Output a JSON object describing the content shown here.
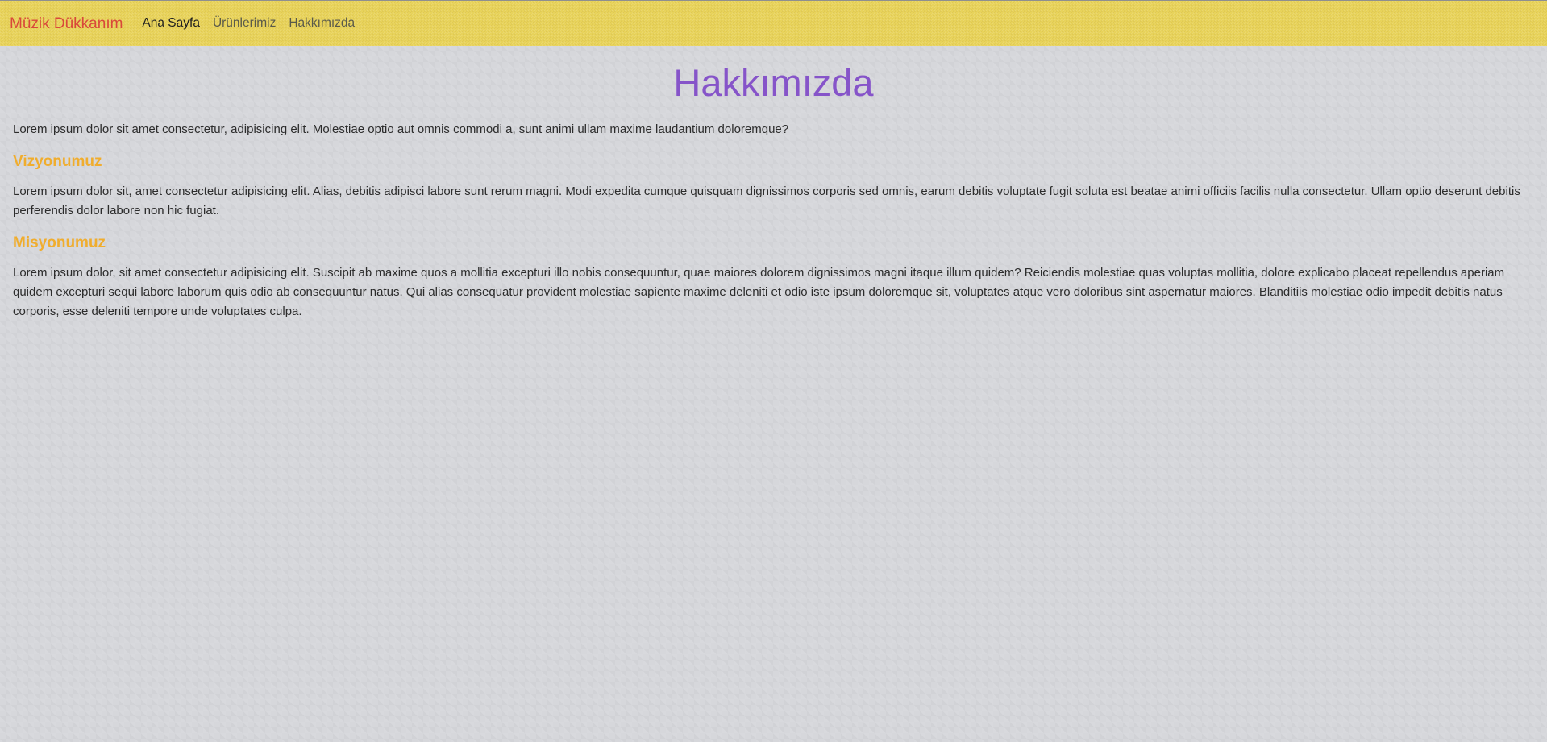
{
  "navbar": {
    "brand": "Müzik Dükkanım",
    "links": [
      {
        "label": "Ana Sayfa"
      },
      {
        "label": "Ürünlerimiz"
      },
      {
        "label": "Hakkımızda"
      }
    ]
  },
  "page": {
    "title": "Hakkımızda",
    "intro": "Lorem ipsum dolor sit amet consectetur, adipisicing elit. Molestiae optio aut omnis commodi a, sunt animi ullam maxime laudantium doloremque?",
    "vision": {
      "title": "Vizyonumuz",
      "text": "Lorem ipsum dolor sit, amet consectetur adipisicing elit. Alias, debitis adipisci labore sunt rerum magni. Modi expedita cumque quisquam dignissimos corporis sed omnis, earum debitis voluptate fugit soluta est beatae animi officiis facilis nulla consectetur. Ullam optio deserunt debitis perferendis dolor labore non hic fugiat."
    },
    "mission": {
      "title": "Misyonumuz",
      "text": "Lorem ipsum dolor, sit amet consectetur adipisicing elit. Suscipit ab maxime quos a mollitia excepturi illo nobis consequuntur, quae maiores dolorem dignissimos magni itaque illum quidem? Reiciendis molestiae quas voluptas mollitia, dolore explicabo placeat repellendus aperiam quidem excepturi sequi labore laborum quis odio ab consequuntur natus. Qui alias consequatur provident molestiae sapiente maxime deleniti et odio iste ipsum doloremque sit, voluptates atque vero doloribus sint aspernatur maiores. Blanditiis molestiae odio impedit debitis natus corporis, esse deleniti tempore unde voluptates culpa."
    }
  },
  "colors": {
    "navbar_bg": "#e8d35a",
    "brand": "#d9483a",
    "title": "#8654c9",
    "section_heading": "#f0ad2e",
    "page_bg": "#d6d7db"
  }
}
